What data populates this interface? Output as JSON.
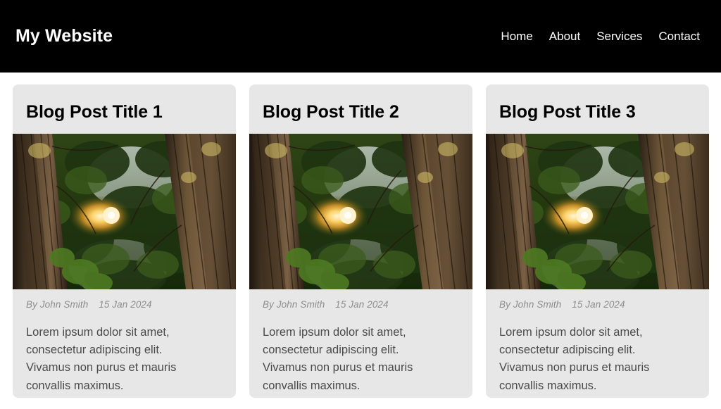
{
  "header": {
    "brand": "My Website",
    "nav": [
      {
        "label": "Home"
      },
      {
        "label": "About"
      },
      {
        "label": "Services"
      },
      {
        "label": "Contact"
      }
    ],
    "background_color": "#000000",
    "text_color": "#ffffff"
  },
  "page": {
    "background_color": "#ffffff",
    "card_background_color": "#e7e7e7"
  },
  "posts": [
    {
      "title": "Blog Post Title 1",
      "author_prefix": "By",
      "author": "John Smith",
      "date": "15 Jan 2024",
      "excerpt": "Lorem ipsum dolor sit amet, consectetur adipiscing elit. Vivamus non purus et mauris convallis maximus.",
      "image_alt": "redwood-forest-canopy-sunlight"
    },
    {
      "title": "Blog Post Title 2",
      "author_prefix": "By",
      "author": "John Smith",
      "date": "15 Jan 2024",
      "excerpt": "Lorem ipsum dolor sit amet, consectetur adipiscing elit. Vivamus non purus et mauris convallis maximus.",
      "image_alt": "redwood-forest-canopy-sunlight"
    },
    {
      "title": "Blog Post Title 3",
      "author_prefix": "By",
      "author": "John Smith",
      "date": "15 Jan 2024",
      "excerpt": "Lorem ipsum dolor sit amet, consectetur adipiscing elit. Vivamus non purus et mauris convallis maximus.",
      "image_alt": "redwood-forest-canopy-sunlight"
    }
  ]
}
